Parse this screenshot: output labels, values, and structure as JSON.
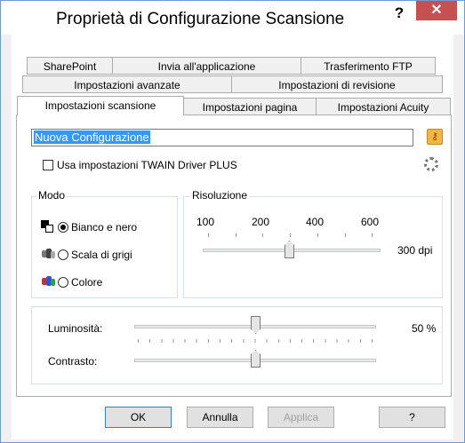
{
  "window": {
    "title": "Proprietà di Configurazione Scansione",
    "help_glyph": "?",
    "close_glyph": "✕"
  },
  "tabs": {
    "row1": [
      "SharePoint",
      "Invia all'applicazione",
      "Trasferimento FTP"
    ],
    "row2": [
      "Impostazioni avanzate",
      "Impostazioni di revisione"
    ],
    "row3": [
      "Impostazioni scansione",
      "Impostazioni pagina",
      "Impostazioni Acuity"
    ]
  },
  "config_name": "Nuova Configurazione",
  "twain_checkbox": {
    "label": "Usa impostazioni TWAIN Driver PLUS",
    "checked": false
  },
  "mode": {
    "title": "Modo",
    "options": [
      "Bianco e nero",
      "Scala di grigi",
      "Colore"
    ],
    "selected": "Bianco e nero"
  },
  "resolution": {
    "title": "Risoluzione",
    "ticks": [
      "100",
      "200",
      "400",
      "600"
    ],
    "value_label": "300 dpi",
    "value": 300
  },
  "brightness": {
    "label": "Luminosità:",
    "value_label": "50 %",
    "value": 50
  },
  "contrast": {
    "label": "Contrasto:"
  },
  "buttons": {
    "ok": "OK",
    "cancel": "Annulla",
    "apply": "Applica",
    "help": "?"
  },
  "icons": [
    "key-icon",
    "gear-icon",
    "black-white-icon",
    "grayscale-icon",
    "color-icon"
  ]
}
